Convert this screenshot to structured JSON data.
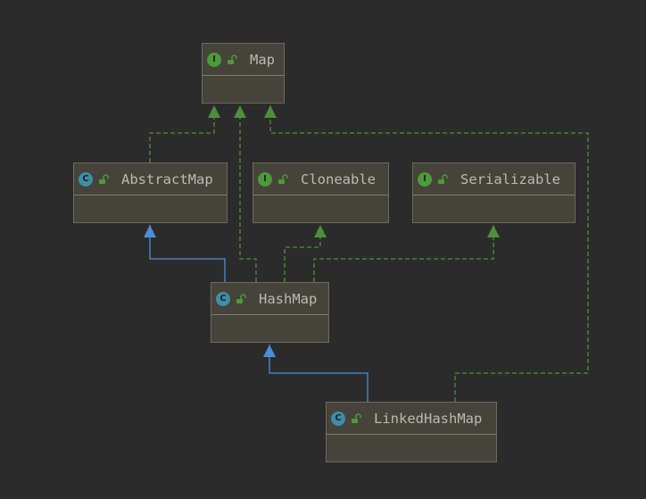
{
  "nodes": {
    "map": {
      "name": "Map",
      "kind": "I"
    },
    "abstract_map": {
      "name": "AbstractMap",
      "kind": "C"
    },
    "cloneable": {
      "name": "Cloneable",
      "kind": "I"
    },
    "serializable": {
      "name": "Serializable",
      "kind": "I"
    },
    "hash_map": {
      "name": "HashMap",
      "kind": "C"
    },
    "linked_hash_map": {
      "name": "LinkedHashMap",
      "kind": "C"
    }
  },
  "colors": {
    "background": "#2b2b2b",
    "node_fill": "#45433a",
    "node_border": "#6d6b60",
    "interface_badge": "#4d9a3a",
    "class_badge": "#3f8ea6",
    "implements_edge": "#4e8f3b",
    "extends_edge": "#4a8ed8",
    "text": "#b9bbb4"
  },
  "icons": {
    "interface": "interface-badge-icon",
    "class": "class-badge-icon",
    "visibility": "open-lock-icon"
  }
}
